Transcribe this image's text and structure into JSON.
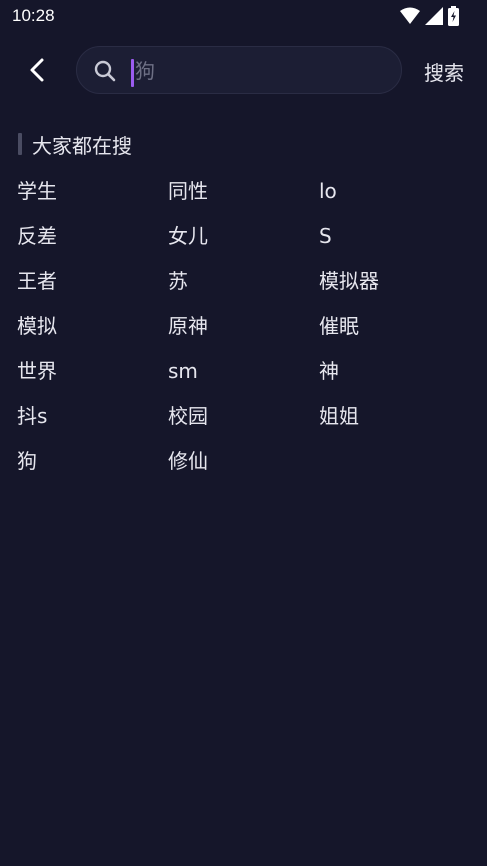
{
  "status_bar": {
    "time": "10:28",
    "icons": [
      "wifi-icon",
      "cellular-signal-icon",
      "battery-charging-icon"
    ]
  },
  "search": {
    "placeholder": "狗",
    "value": "",
    "submit_label": "搜索"
  },
  "section": {
    "title": "大家都在搜"
  },
  "tags": [
    "学生",
    "同性",
    "lo",
    "反差",
    "女儿",
    "S",
    "王者",
    "苏",
    "模拟器",
    "模拟",
    "原神",
    "催眠",
    "世界",
    "sm",
    "神",
    "抖s",
    "校园",
    "姐姐",
    "狗",
    "修仙"
  ],
  "colors": {
    "background": "#15162a",
    "search_box": "#1c1e34",
    "caret_accent": "#9b5cf0",
    "text": "#e6e6ee",
    "placeholder": "#6e7085"
  }
}
